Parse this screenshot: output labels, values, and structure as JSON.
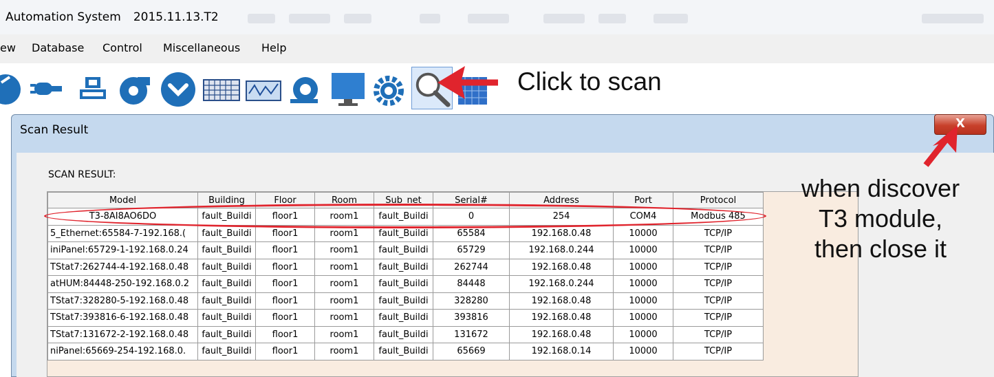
{
  "app": {
    "title": "Automation System",
    "version": "2015.11.13.T2"
  },
  "menu": [
    "ew",
    "Database",
    "Control",
    "Miscellaneous",
    "Help"
  ],
  "toolbar": {
    "icons": [
      "building-icon",
      "plug-icon",
      "network-icon",
      "fan-icon",
      "chevron-circle-icon",
      "keyboard-icon",
      "chart-icon",
      "alarm-bell-icon",
      "monitor-icon",
      "gear-icon",
      "search-icon",
      "grid-icon"
    ]
  },
  "annotations": {
    "click_to_scan": "Click to scan",
    "discover_line1": "when discover",
    "discover_line2": "T3 module,",
    "discover_line3": "then close it"
  },
  "dialog": {
    "title": "Scan Result",
    "close_label": "X",
    "section_label": "SCAN RESULT:",
    "columns": [
      "Model",
      "Building",
      "Floor",
      "Room",
      "Sub_net",
      "Serial#",
      "Address",
      "Port",
      "Protocol"
    ],
    "rows": [
      [
        "T3-8AI8AO6DO",
        "fault_Buildi",
        "floor1",
        "room1",
        "fault_Buildi",
        "0",
        "254",
        "COM4",
        "Modbus 485"
      ],
      [
        "5_Ethernet:65584-7-192.168.(",
        "fault_Buildi",
        "floor1",
        "room1",
        "fault_Buildi",
        "65584",
        "192.168.0.48",
        "10000",
        "TCP/IP"
      ],
      [
        "iniPanel:65729-1-192.168.0.24",
        "fault_Buildi",
        "floor1",
        "room1",
        "fault_Buildi",
        "65729",
        "192.168.0.244",
        "10000",
        "TCP/IP"
      ],
      [
        "TStat7:262744-4-192.168.0.48",
        "fault_Buildi",
        "floor1",
        "room1",
        "fault_Buildi",
        "262744",
        "192.168.0.48",
        "10000",
        "TCP/IP"
      ],
      [
        "atHUM:84448-250-192.168.0.2",
        "fault_Buildi",
        "floor1",
        "room1",
        "fault_Buildi",
        "84448",
        "192.168.0.244",
        "10000",
        "TCP/IP"
      ],
      [
        "TStat7:328280-5-192.168.0.48",
        "fault_Buildi",
        "floor1",
        "room1",
        "fault_Buildi",
        "328280",
        "192.168.0.48",
        "10000",
        "TCP/IP"
      ],
      [
        "TStat7:393816-6-192.168.0.48",
        "fault_Buildi",
        "floor1",
        "room1",
        "fault_Buildi",
        "393816",
        "192.168.0.48",
        "10000",
        "TCP/IP"
      ],
      [
        "TStat7:131672-2-192.168.0.48",
        "fault_Buildi",
        "floor1",
        "room1",
        "fault_Buildi",
        "131672",
        "192.168.0.48",
        "10000",
        "TCP/IP"
      ],
      [
        "niPanel:65669-254-192.168.0.",
        "fault_Buildi",
        "floor1",
        "room1",
        "fault_Buildi",
        "65669",
        "192.168.0.14",
        "10000",
        "TCP/IP"
      ]
    ]
  },
  "colors": {
    "annotation_red": "#e0242d",
    "close_button": "#c8412b",
    "dialog_frame": "#c5d9ee"
  }
}
